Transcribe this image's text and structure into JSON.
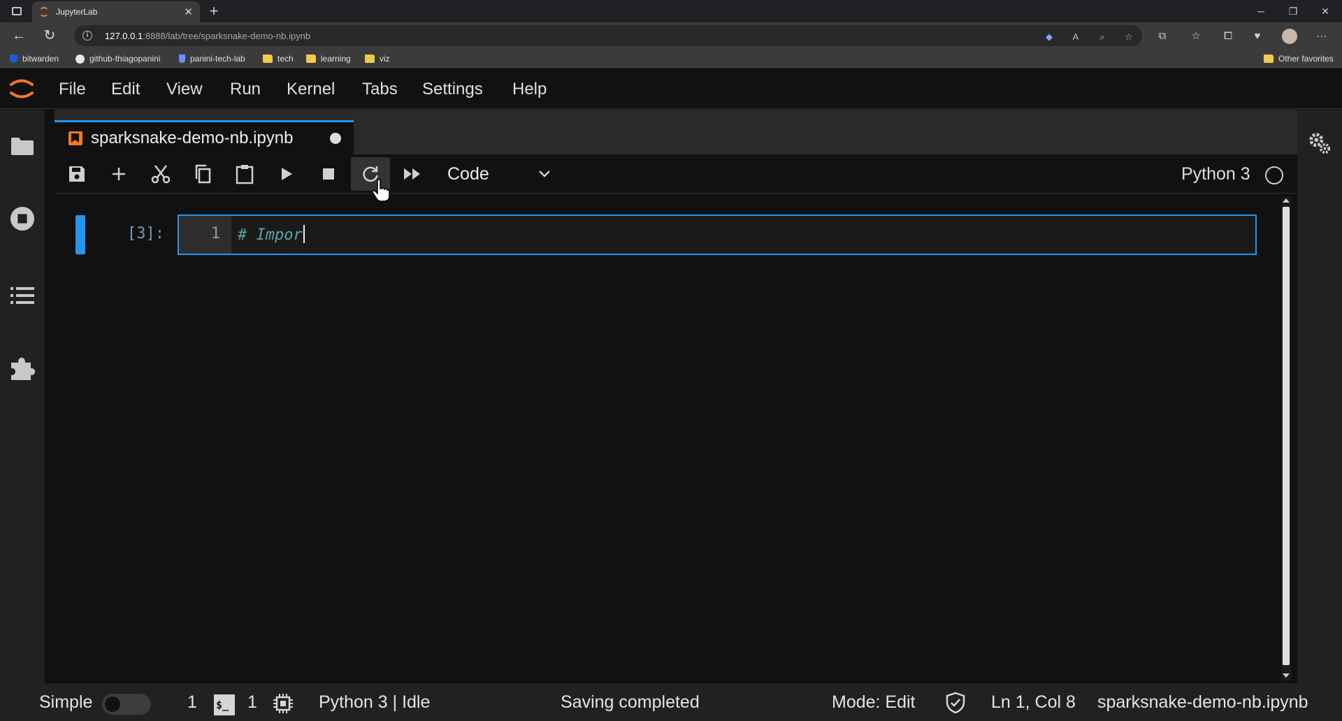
{
  "browser": {
    "tab_title": "JupyterLab",
    "url_host": "127.0.0.1",
    "url_path": ":8888/lab/tree/sparksnake-demo-nb.ipynb",
    "bookmarks": [
      "bitwarden",
      "github-thiagopanini",
      "panini-tech-lab",
      "tech",
      "learning",
      "viz"
    ],
    "other_favorites": "Other favorites"
  },
  "menu": {
    "items": [
      "File",
      "Edit",
      "View",
      "Run",
      "Kernel",
      "Tabs",
      "Settings",
      "Help"
    ]
  },
  "notebook": {
    "tab_title": "sparksnake-demo-nb.ipynb",
    "cell_type": "Code",
    "kernel_name": "Python 3",
    "cell": {
      "prompt": "[3]:",
      "line_number": "1",
      "code": "# Impor"
    }
  },
  "statusbar": {
    "simple_label": "Simple",
    "terminals_count": "1",
    "terminal_glyph": "$_",
    "kernels_count": "1",
    "kernel_status": "Python 3 | Idle",
    "save_status": "Saving completed",
    "mode": "Mode: Edit",
    "cursor_position": "Ln 1, Col 8",
    "file_name": "sparksnake-demo-nb.ipynb"
  },
  "colors": {
    "accent": "#2196f3",
    "jupyter_orange": "#f37726",
    "background": "#111111"
  }
}
